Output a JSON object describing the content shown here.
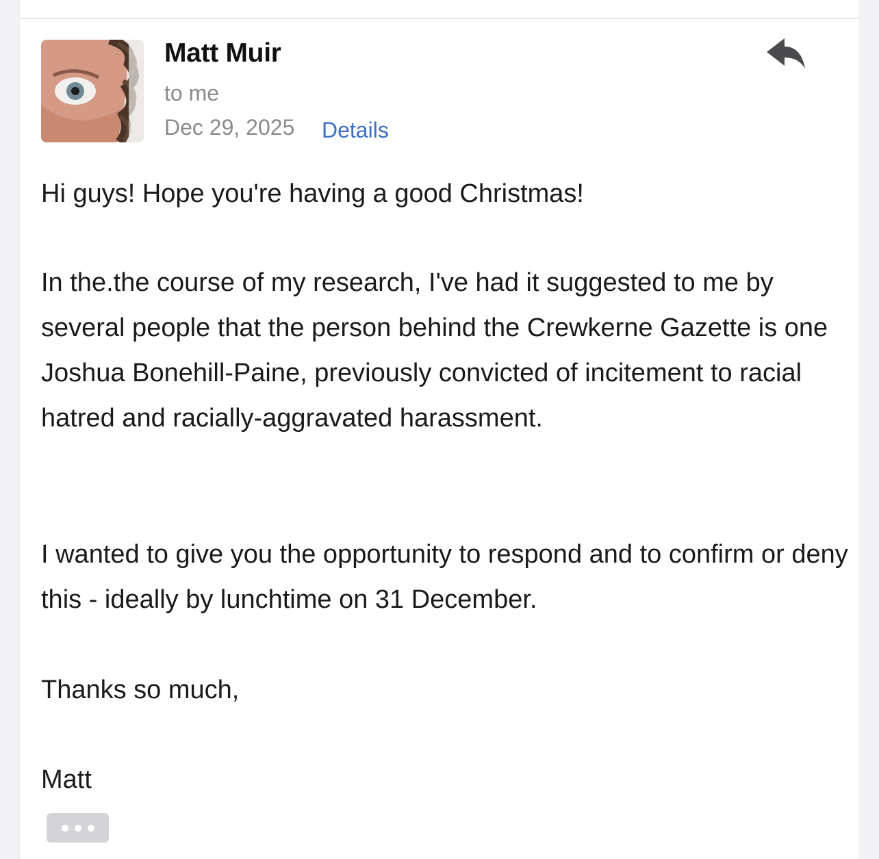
{
  "email": {
    "sender_name": "Matt Muir",
    "recipient": "to me",
    "date": "Dec 29, 2025",
    "details_label": "Details",
    "avatar_icon": "sender-avatar-photo",
    "reply_icon": "reply-arrow-icon",
    "more_icon": "ellipsis-icon",
    "body": {
      "greeting": "Hi guys! Hope you're having a good Christmas!",
      "research": "In the.the course of my research, I've had it suggested to me by several people that the person behind the Crewkerne Gazette is one Joshua Bonehill-Paine, previously convicted of incitement to racial hatred and racially-aggravated harassment.",
      "request": "I wanted to give you the opportunity to respond and to confirm or deny this - ideally by lunchtime on 31 December.",
      "thanks": "Thanks so much,",
      "signature": "Matt"
    }
  },
  "colors": {
    "background": "#f2f2f4",
    "card": "#ffffff",
    "link": "#3a6fc4",
    "secondary_text": "#8a8a8e",
    "primary_text": "#1a1a1a"
  }
}
